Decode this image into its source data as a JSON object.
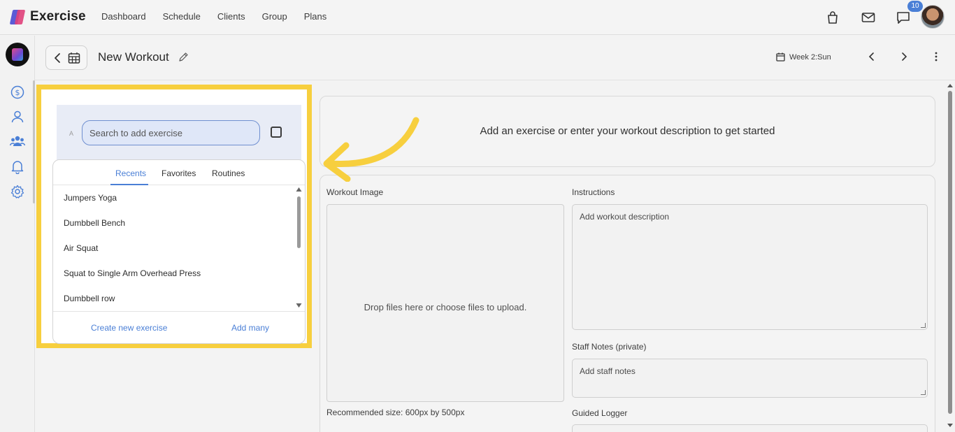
{
  "app": {
    "name": "Exercise"
  },
  "nav": [
    {
      "label": "Dashboard"
    },
    {
      "label": "Schedule"
    },
    {
      "label": "Clients"
    },
    {
      "label": "Group"
    },
    {
      "label": "Plans"
    }
  ],
  "top_icons": [
    "shopping-bag-icon",
    "mail-icon",
    "chat-icon"
  ],
  "notifications": {
    "count": "10"
  },
  "sidebar": {
    "icons": [
      "dollar-icon",
      "user-icon",
      "group-icon",
      "bell-icon",
      "gear-icon"
    ]
  },
  "header": {
    "title": "New Workout",
    "week_label": "Week 2:Sun"
  },
  "search": {
    "row_letter": "A",
    "placeholder": "Search to add exercise"
  },
  "dropdown": {
    "tabs": [
      {
        "label": "Recents",
        "active": true
      },
      {
        "label": "Favorites",
        "active": false
      },
      {
        "label": "Routines",
        "active": false
      }
    ],
    "items": [
      "Jumpers Yoga",
      "Dumbbell Bench",
      "Air Squat",
      "Squat to Single Arm Overhead Press",
      "Dumbbell row"
    ],
    "create_label": "Create new exercise",
    "add_many_label": "Add many"
  },
  "main": {
    "empty_prompt": "Add an exercise or enter your workout description to get started",
    "workout_image_label": "Workout Image",
    "dropzone_text": "Drop files here or choose files to upload.",
    "recommended_size": "Recommended size: 600px by 500px",
    "instructions_label": "Instructions",
    "instructions_placeholder": "Add workout description",
    "staff_notes_label": "Staff Notes (private)",
    "staff_notes_placeholder": "Add staff notes",
    "guided_logger_label": "Guided Logger"
  },
  "colors": {
    "accent": "#4a7fd6",
    "highlight": "#f7cf3e",
    "search_band": "#e8ecf6"
  }
}
